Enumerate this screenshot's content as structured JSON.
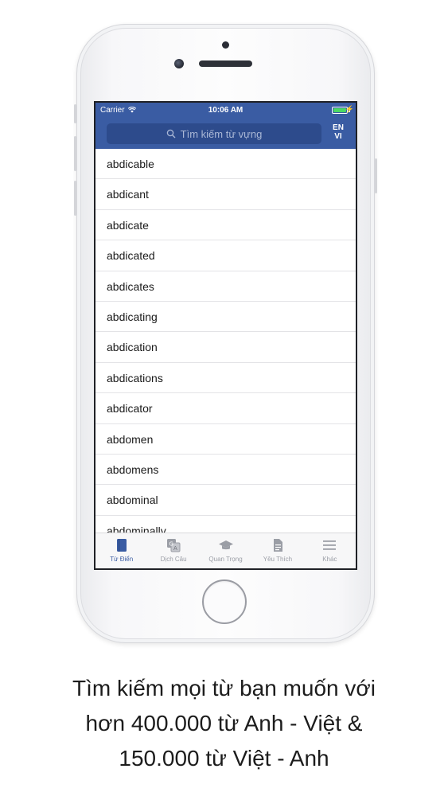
{
  "status_bar": {
    "carrier": "Carrier",
    "time": "10:06 AM"
  },
  "search": {
    "placeholder": "Tìm kiếm từ vựng"
  },
  "language_toggle": {
    "from": "EN",
    "to": "VI"
  },
  "words": [
    "abdicable",
    "abdicant",
    "abdicate",
    "abdicated",
    "abdicates",
    "abdicating",
    "abdication",
    "abdications",
    "abdicator",
    "abdomen",
    "abdomens",
    "abdominal",
    "abdominally"
  ],
  "tabs": [
    {
      "label": "Từ Điển",
      "icon": "dictionary-book-icon",
      "active": true
    },
    {
      "label": "Dịch Câu",
      "icon": "translate-icon",
      "active": false
    },
    {
      "label": "Quan Trọng",
      "icon": "graduation-cap-icon",
      "active": false
    },
    {
      "label": "Yêu Thích",
      "icon": "document-icon",
      "active": false
    },
    {
      "label": "Khác",
      "icon": "menu-icon",
      "active": false
    }
  ],
  "caption": {
    "line1": "Tìm kiếm mọi từ bạn muốn với",
    "line2": "hơn 400.000 từ Anh - Việt &",
    "line3": "150.000 từ Việt - Anh"
  },
  "colors": {
    "nav_blue": "#3a5ca3",
    "search_bg": "#2d4b8c",
    "inactive_tab": "#9b9ea6"
  }
}
